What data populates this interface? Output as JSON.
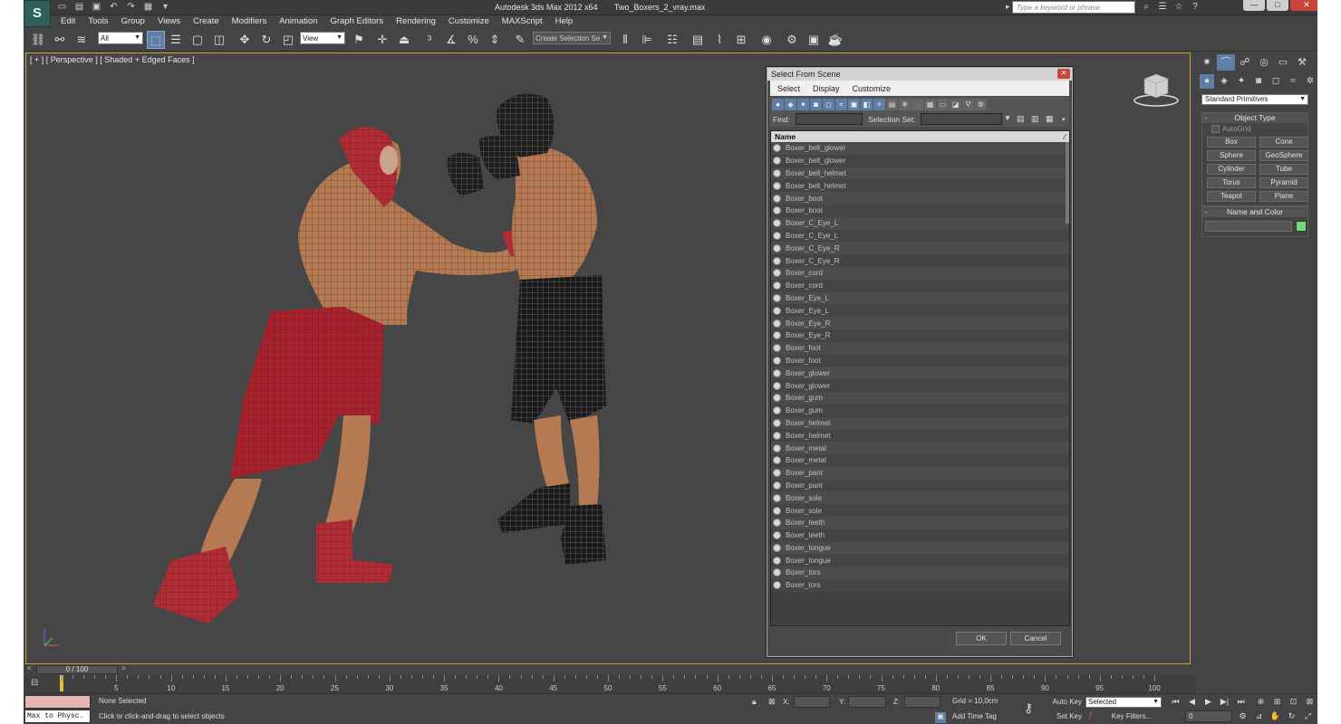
{
  "app": {
    "logo": "S",
    "title": "Autodesk 3ds Max  2012 x64",
    "file": "Two_Boxers_2_vray.max",
    "search_placeholder": "Type a keyword or phrase",
    "win_min": "—",
    "win_max": "□",
    "win_close": "✕"
  },
  "menu": [
    "Edit",
    "Tools",
    "Group",
    "Views",
    "Create",
    "Modifiers",
    "Animation",
    "Graph Editors",
    "Rendering",
    "Customize",
    "MAXScript",
    "Help"
  ],
  "toolbar": {
    "filter_select": "All",
    "ref_coord": "View",
    "selection_set_placeholder": "Create Selection Se"
  },
  "viewport": {
    "label": "[ + ] [ Perspective ] [ Shaded + Edged Faces ]"
  },
  "command_panel": {
    "category": "Standard Primitives",
    "object_type_title": "Object Type",
    "autogrid": "AutoGrid",
    "buttons": [
      "Box",
      "Cone",
      "Sphere",
      "GeoSphere",
      "Cylinder",
      "Tube",
      "Torus",
      "Pyramid",
      "Teapot",
      "Plane"
    ],
    "name_color_title": "Name and Color",
    "object_color": "#6fdc78"
  },
  "timeline": {
    "slider": "0 / 100",
    "ticks": [
      5,
      10,
      15,
      20,
      25,
      30,
      35,
      40,
      45,
      50,
      55,
      60,
      65,
      70,
      75,
      80,
      85,
      90,
      95,
      100
    ]
  },
  "status": {
    "maxscript": "Max to Physc.",
    "selected": "None Selected",
    "prompt": "Click or click-and-drag to select objects",
    "x_label": "X:",
    "y_label": "Y:",
    "z_label": "Z:",
    "grid": "Grid = 10,0cm",
    "add_time_tag": "Add Time Tag",
    "auto_key": "Auto Key",
    "set_key": "Set Key",
    "key_mode": "Selected",
    "key_filters": "Key Filters...",
    "frame": "0"
  },
  "dialog": {
    "title": "Select From Scene",
    "close": "✕",
    "menu": [
      "Select",
      "Display",
      "Customize"
    ],
    "find_label": "Find:",
    "selection_set_label": "Selection Set:",
    "column": "Name",
    "items": [
      "Boxer_belt_glower",
      "Boxer_belt_glower",
      "Boxer_belt_helmet",
      "Boxer_belt_helmet",
      "Boxer_boot",
      "Boxer_boot",
      "Boxer_C_Eye_L",
      "Boxer_C_Eye_L",
      "Boxer_C_Eye_R",
      "Boxer_C_Eye_R",
      "Boxer_cord",
      "Boxer_cord",
      "Boxer_Eye_L",
      "Boxer_Eye_L",
      "Boxer_Eye_R",
      "Boxer_Eye_R",
      "Boxer_foot",
      "Boxer_foot",
      "Boxer_glower",
      "Boxer_glower",
      "Boxer_gum",
      "Boxer_gum",
      "Boxer_helmet",
      "Boxer_helmet",
      "Boxer_metal",
      "Boxer_metal",
      "Boxer_pant",
      "Boxer_pant",
      "Boxer_sole",
      "Boxer_sole",
      "Boxer_teeth",
      "Boxer_teeth",
      "Boxer_tongue",
      "Boxer_tongue",
      "Boxer_tors",
      "Boxer_tors"
    ],
    "ok": "OK",
    "cancel": "Cancel"
  }
}
